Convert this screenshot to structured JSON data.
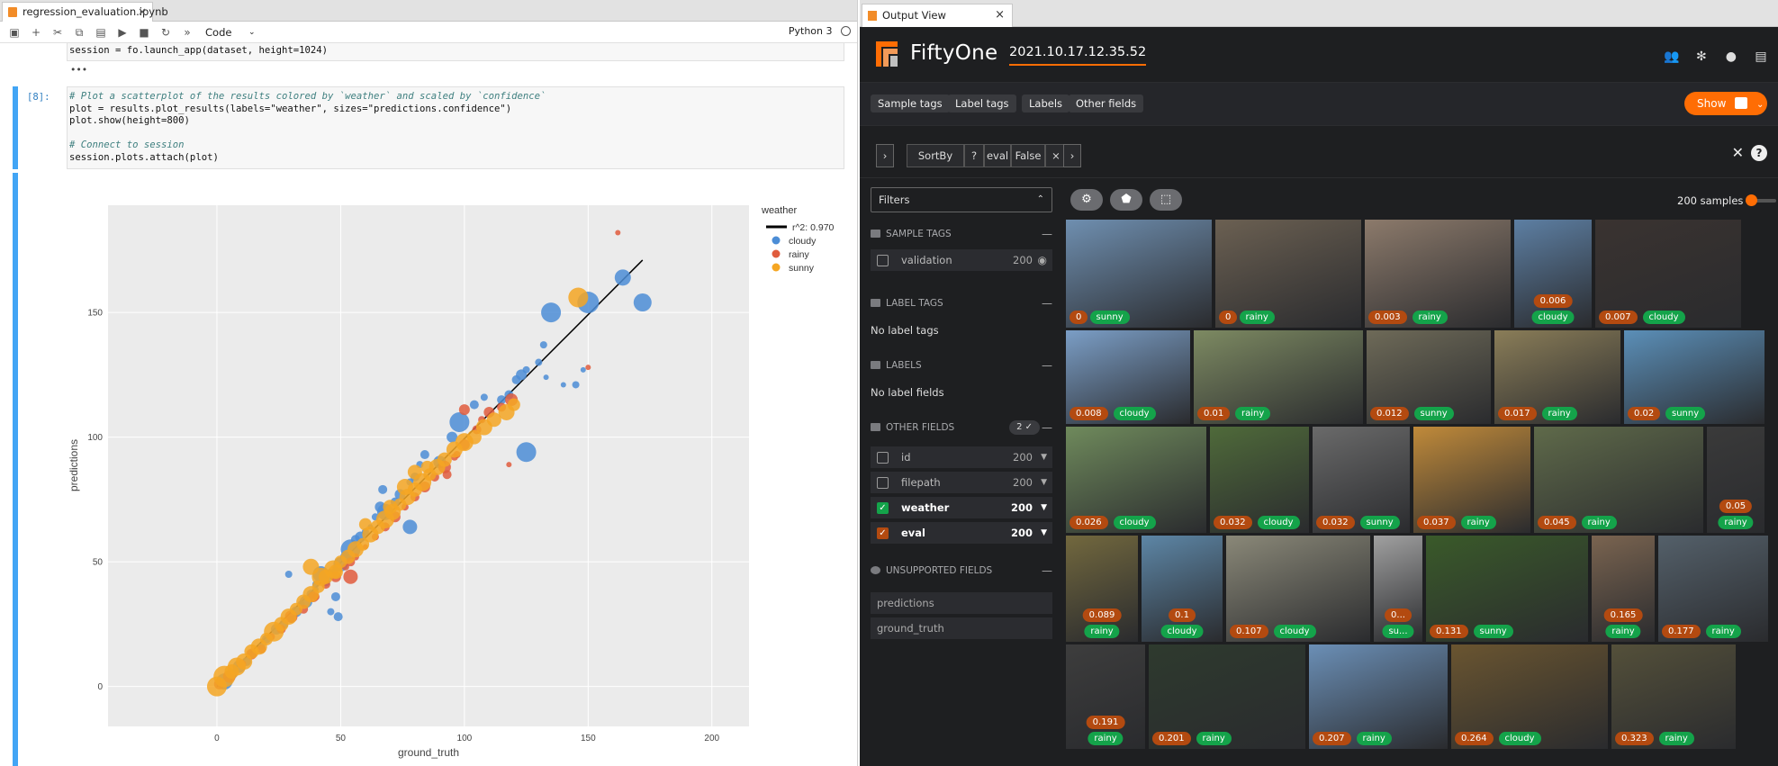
{
  "notebook": {
    "tab_title": "regression_evaluation.ipynb",
    "cell_type": "Code",
    "kernel": "Python 3",
    "prev_cell_code": "session = fo.launch_app(dataset, height=1024)",
    "prev_output": "•••",
    "prompt": "[8]:",
    "code_lines": [
      "# Plot a scatterplot of the results colored by `weather` and scaled by `confidence`",
      "plot = results.plot_results(labels=\"weather\", sizes=\"predictions.confidence\")",
      "plot.show(height=800)",
      "",
      "# Connect to session",
      "session.plots.attach(plot)"
    ]
  },
  "chart_data": {
    "type": "scatter",
    "xlabel": "ground_truth",
    "ylabel": "predictions",
    "xlim": [
      -44,
      215
    ],
    "ylim": [
      -16,
      193
    ],
    "xticks": [
      0,
      50,
      100,
      150,
      200
    ],
    "yticks": [
      0,
      50,
      100,
      150
    ],
    "legend_title": "weather",
    "legend_placement": "top-right",
    "fit_line": {
      "name": "r^2: 0.970",
      "x": [
        0,
        172
      ],
      "y": [
        0,
        171
      ]
    },
    "series": [
      {
        "name": "cloudy",
        "color": "#4c8dd6",
        "points": [
          [
            3,
            2,
            9
          ],
          [
            6,
            5,
            6
          ],
          [
            9,
            8,
            7
          ],
          [
            12,
            10,
            5
          ],
          [
            14,
            13,
            5
          ],
          [
            18,
            16,
            4
          ],
          [
            20,
            19,
            5
          ],
          [
            24,
            23,
            6
          ],
          [
            27,
            25,
            5
          ],
          [
            30,
            27,
            4
          ],
          [
            32,
            30,
            6
          ],
          [
            34,
            33,
            4
          ],
          [
            36,
            34,
            7
          ],
          [
            38,
            37,
            5
          ],
          [
            40,
            39,
            3
          ],
          [
            42,
            45,
            9
          ],
          [
            44,
            42,
            5
          ],
          [
            46,
            45,
            6
          ],
          [
            48,
            47,
            4
          ],
          [
            50,
            49,
            8
          ],
          [
            52,
            52,
            6
          ],
          [
            54,
            55,
            11
          ],
          [
            56,
            59,
            5
          ],
          [
            58,
            60,
            6
          ],
          [
            60,
            62,
            4
          ],
          [
            62,
            64,
            3
          ],
          [
            64,
            68,
            4
          ],
          [
            66,
            72,
            6
          ],
          [
            68,
            70,
            9
          ],
          [
            72,
            74,
            5
          ],
          [
            74,
            77,
            6
          ],
          [
            78,
            82,
            4
          ],
          [
            80,
            84,
            5
          ],
          [
            82,
            89,
            4
          ],
          [
            84,
            93,
            5
          ],
          [
            90,
            90,
            7
          ],
          [
            95,
            100,
            6
          ],
          [
            98,
            106,
            11
          ],
          [
            104,
            113,
            5
          ],
          [
            108,
            116,
            4
          ],
          [
            115,
            115,
            5
          ],
          [
            118,
            117,
            5
          ],
          [
            121,
            123,
            5
          ],
          [
            123,
            125,
            6
          ],
          [
            125,
            127,
            4
          ],
          [
            130,
            130,
            4
          ],
          [
            133,
            124,
            3
          ],
          [
            140,
            121,
            3
          ],
          [
            145,
            121,
            4
          ],
          [
            148,
            127,
            3
          ],
          [
            125,
            94,
            11
          ],
          [
            78,
            64,
            8
          ],
          [
            40,
            41,
            4
          ],
          [
            49,
            28,
            5
          ],
          [
            48,
            36,
            5
          ],
          [
            29,
            45,
            4
          ],
          [
            46,
            30,
            4
          ],
          [
            67,
            79,
            5
          ],
          [
            135,
            150,
            11
          ],
          [
            150,
            154,
            12
          ],
          [
            164,
            164,
            9
          ],
          [
            172,
            154,
            10
          ],
          [
            132,
            137,
            4
          ]
        ]
      },
      {
        "name": "rainy",
        "color": "#e05c3d",
        "points": [
          [
            1,
            1,
            6
          ],
          [
            5,
            4,
            7
          ],
          [
            10,
            9,
            5
          ],
          [
            14,
            13,
            6
          ],
          [
            18,
            15,
            5
          ],
          [
            22,
            20,
            4
          ],
          [
            26,
            23,
            5
          ],
          [
            30,
            28,
            7
          ],
          [
            35,
            31,
            5
          ],
          [
            40,
            36,
            4
          ],
          [
            44,
            41,
            5
          ],
          [
            48,
            44,
            6
          ],
          [
            52,
            48,
            4
          ],
          [
            54,
            50,
            5
          ],
          [
            56,
            52,
            4
          ],
          [
            60,
            56,
            3
          ],
          [
            64,
            60,
            4
          ],
          [
            68,
            64,
            5
          ],
          [
            72,
            68,
            6
          ],
          [
            76,
            72,
            4
          ],
          [
            80,
            76,
            5
          ],
          [
            84,
            80,
            6
          ],
          [
            88,
            84,
            5
          ],
          [
            92,
            88,
            7
          ],
          [
            96,
            92,
            4
          ],
          [
            100,
            97,
            6
          ],
          [
            105,
            103,
            5
          ],
          [
            110,
            110,
            6
          ],
          [
            115,
            112,
            5
          ],
          [
            119,
            115,
            7
          ],
          [
            54,
            44,
            8
          ],
          [
            39,
            36,
            6
          ],
          [
            93,
            85,
            5
          ],
          [
            118,
            89,
            3
          ],
          [
            150,
            128,
            3
          ],
          [
            162,
            182,
            3
          ],
          [
            100,
            111,
            6
          ],
          [
            107,
            107,
            4
          ],
          [
            97,
            93,
            4
          ]
        ]
      },
      {
        "name": "sunny",
        "color": "#f5a623",
        "points": [
          [
            0,
            0,
            11
          ],
          [
            3,
            4,
            12
          ],
          [
            6,
            6,
            8
          ],
          [
            8,
            8,
            10
          ],
          [
            11,
            10,
            9
          ],
          [
            14,
            14,
            8
          ],
          [
            17,
            16,
            9
          ],
          [
            20,
            19,
            7
          ],
          [
            23,
            22,
            11
          ],
          [
            26,
            25,
            8
          ],
          [
            29,
            28,
            9
          ],
          [
            32,
            31,
            7
          ],
          [
            35,
            34,
            8
          ],
          [
            38,
            37,
            9
          ],
          [
            41,
            40,
            7
          ],
          [
            44,
            44,
            8
          ],
          [
            47,
            47,
            10
          ],
          [
            50,
            50,
            7
          ],
          [
            53,
            52,
            8
          ],
          [
            56,
            55,
            9
          ],
          [
            59,
            57,
            7
          ],
          [
            62,
            61,
            9
          ],
          [
            65,
            64,
            8
          ],
          [
            68,
            67,
            10
          ],
          [
            71,
            70,
            9
          ],
          [
            74,
            73,
            7
          ],
          [
            77,
            76,
            9
          ],
          [
            80,
            79,
            8
          ],
          [
            83,
            82,
            10
          ],
          [
            86,
            85,
            7
          ],
          [
            89,
            88,
            9
          ],
          [
            92,
            91,
            8
          ],
          [
            96,
            95,
            9
          ],
          [
            100,
            98,
            10
          ],
          [
            104,
            100,
            8
          ],
          [
            108,
            104,
            9
          ],
          [
            112,
            107,
            8
          ],
          [
            117,
            110,
            9
          ],
          [
            120,
            113,
            7
          ],
          [
            38,
            48,
            9
          ],
          [
            42,
            44,
            10
          ],
          [
            48,
            46,
            8
          ],
          [
            60,
            65,
            7
          ],
          [
            70,
            72,
            8
          ],
          [
            76,
            80,
            9
          ],
          [
            80,
            86,
            8
          ],
          [
            85,
            88,
            7
          ],
          [
            146,
            156,
            11
          ]
        ]
      }
    ]
  },
  "fiftyone": {
    "tab_title": "Output View",
    "brand": "FiftyOne",
    "dataset": "2021.10.17.12.35.52",
    "pills": [
      "Sample tags",
      "Label tags",
      "Labels",
      "Other fields"
    ],
    "show_label": "Show",
    "view_stage": {
      "name": "SortBy",
      "help": "?",
      "field": "eval",
      "value": "False",
      "remove": "×"
    },
    "filters_label": "Filters",
    "sections": {
      "sample_tags": "SAMPLE TAGS",
      "label_tags": "LABEL TAGS",
      "labels": "LABELS",
      "other_fields": "OTHER FIELDS",
      "unsupported": "UNSUPPORTED FIELDS"
    },
    "sample_tag_row": {
      "label": "validation",
      "count": "200"
    },
    "no_label_tags": "No label tags",
    "no_label_fields": "No label fields",
    "other_fields_badge": "2 ✓",
    "other_field_rows": [
      {
        "label": "id",
        "count": "200",
        "checked": false,
        "color": "#999999"
      },
      {
        "label": "filepath",
        "count": "200",
        "checked": false,
        "color": "#999999"
      },
      {
        "label": "weather",
        "count": "200",
        "checked": true,
        "color": "#14a34a"
      },
      {
        "label": "eval",
        "count": "200",
        "checked": true,
        "color": "#b34a10"
      }
    ],
    "unsupported_fields": [
      "predictions",
      "ground_truth"
    ],
    "sample_count": "200 samples",
    "tiles": [
      {
        "eval": "0",
        "weather": "sunny"
      },
      {
        "eval": "0",
        "weather": "rainy"
      },
      {
        "eval": "0.003",
        "weather": "rainy"
      },
      {
        "eval": "0.006",
        "weather": "cloudy"
      },
      {
        "eval": "0.007",
        "weather": "cloudy"
      },
      {
        "eval": "0.008",
        "weather": "cloudy"
      },
      {
        "eval": "0.01",
        "weather": "rainy"
      },
      {
        "eval": "0.012",
        "weather": "sunny"
      },
      {
        "eval": "0.017",
        "weather": "rainy"
      },
      {
        "eval": "0.02",
        "weather": "sunny"
      },
      {
        "eval": "0.026",
        "weather": "cloudy"
      },
      {
        "eval": "0.032",
        "weather": "cloudy"
      },
      {
        "eval": "0.032",
        "weather": "sunny"
      },
      {
        "eval": "0.037",
        "weather": "rainy"
      },
      {
        "eval": "0.045",
        "weather": "rainy"
      },
      {
        "eval": "0.05",
        "weather": "rainy"
      },
      {
        "eval": "0.089",
        "weather": "rainy"
      },
      {
        "eval": "0.1",
        "weather": "cloudy"
      },
      {
        "eval": "0.107",
        "weather": "cloudy"
      },
      {
        "eval": "0...",
        "weather": "su..."
      },
      {
        "eval": "0.131",
        "weather": "sunny"
      },
      {
        "eval": "0.165",
        "weather": "rainy"
      },
      {
        "eval": "0.177",
        "weather": "rainy"
      },
      {
        "eval": "0.191",
        "weather": "rainy"
      },
      {
        "eval": "0.201",
        "weather": "rainy"
      },
      {
        "eval": "0.207",
        "weather": "rainy"
      },
      {
        "eval": "0.264",
        "weather": "cloudy"
      },
      {
        "eval": "0.323",
        "weather": "rainy"
      }
    ]
  }
}
